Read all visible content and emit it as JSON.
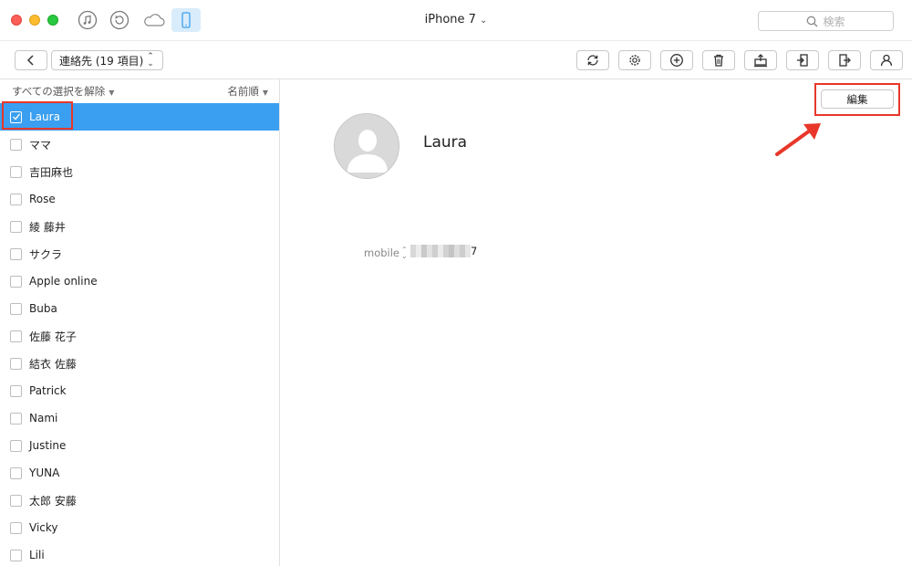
{
  "titlebar": {
    "device_name": "iPhone 7",
    "search_placeholder": "検索",
    "icons": [
      "music-icon",
      "restore-icon",
      "cloud-icon",
      "phone-icon"
    ]
  },
  "toolbar": {
    "category_label": "連絡先 (19 項目)",
    "tools": [
      "refresh-icon",
      "settings-icon",
      "add-icon",
      "delete-icon",
      "export-to-computer-icon",
      "import-icon",
      "export-icon",
      "export-to-device-icon"
    ]
  },
  "sidebar": {
    "deselect_all_label": "すべての選択を解除",
    "sort_label": "名前順",
    "contacts": [
      {
        "name": "Laura",
        "selected": true
      },
      {
        "name": "ママ",
        "selected": false
      },
      {
        "name": "吉田麻也",
        "selected": false
      },
      {
        "name": "Rose",
        "selected": false
      },
      {
        "name": "綾 藤井",
        "selected": false
      },
      {
        "name": "サクラ",
        "selected": false
      },
      {
        "name": "Apple online",
        "selected": false
      },
      {
        "name": "Buba",
        "selected": false
      },
      {
        "name": "佐藤 花子",
        "selected": false
      },
      {
        "name": "結衣 佐藤",
        "selected": false
      },
      {
        "name": "Patrick",
        "selected": false
      },
      {
        "name": "Nami",
        "selected": false
      },
      {
        "name": "Justine",
        "selected": false
      },
      {
        "name": "YUNA",
        "selected": false
      },
      {
        "name": "太郎 安藤",
        "selected": false
      },
      {
        "name": "Vicky",
        "selected": false
      },
      {
        "name": "Lili",
        "selected": false
      }
    ]
  },
  "detail": {
    "edit_label": "編集",
    "contact_name": "Laura",
    "phone_label": "mobile",
    "phone_visible_suffix": "7"
  },
  "colors": {
    "selection": "#3a9ff0",
    "highlight": "#e8372a",
    "active_tab": "#d9ecfb"
  }
}
